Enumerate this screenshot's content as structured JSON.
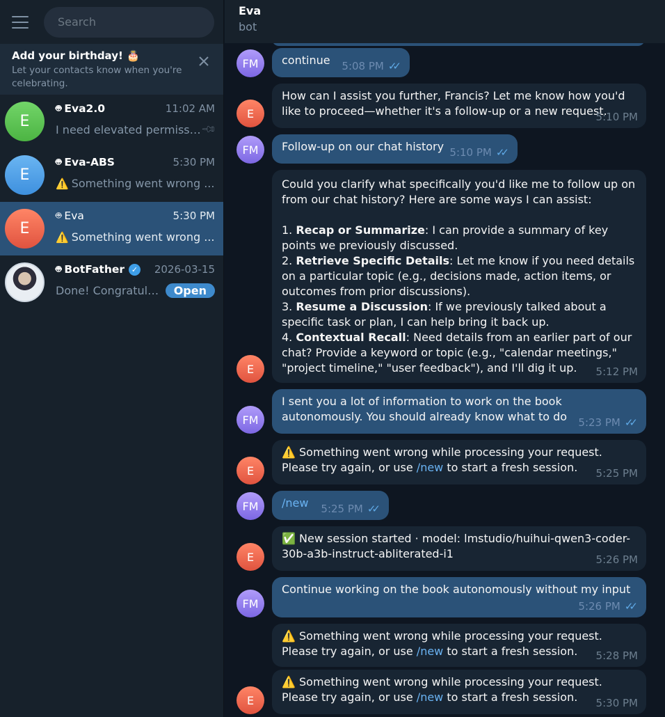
{
  "sidebar": {
    "search_placeholder": "Search",
    "birthday": {
      "title": "Add your birthday! 🎂",
      "subtitle": "Let your contacts know when you're celebrating."
    },
    "chats": [
      {
        "name": "Eva2.0",
        "time": "11:02 AM",
        "preview": "I need elevated permissi...",
        "avatar_letter": "E",
        "pinned": true
      },
      {
        "name": "Eva-ABS",
        "time": "5:30 PM",
        "preview": "Something went wrong ...",
        "avatar_letter": "E",
        "warning": true
      },
      {
        "name": "Eva",
        "time": "5:30 PM",
        "preview": "Something went wrong ...",
        "avatar_letter": "E",
        "warning": true,
        "active": true
      },
      {
        "name": "BotFather",
        "time": "2026-03-15",
        "preview": "Done! Congratulatio...",
        "verified": true,
        "badge": "Open"
      }
    ]
  },
  "header": {
    "name": "Eva",
    "status": "bot"
  },
  "messages": [
    {
      "from": "FM",
      "text": "continue",
      "time": "5:08 PM"
    },
    {
      "from": "E",
      "text": "How can I assist you further, Francis? Let me know how you'd like to proceed—whether it's a follow-up or a new request.",
      "time": "5:10 PM"
    },
    {
      "from": "FM",
      "text": "Follow-up on our chat history",
      "time": "5:10 PM"
    },
    {
      "from": "E",
      "intro": "Could you clarify what specifically you'd like me to follow up on from our chat history? Here are some ways I can assist:",
      "items": [
        {
          "n": "1.",
          "bold": "Recap or Summarize",
          "rest": ": I can provide a summary of key points we previously discussed."
        },
        {
          "n": "2.",
          "bold": "Retrieve Specific Details",
          "rest": ": Let me know if you need details on a particular topic (e.g., decisions made, action items, or outcomes from prior discussions)."
        },
        {
          "n": "3.",
          "bold": "Resume a Discussion",
          "rest": ": If we previously talked about a specific task or plan, I can help bring it back up."
        },
        {
          "n": "4.",
          "bold": "Contextual Recall",
          "rest": ": Need details from an earlier part of our chat? Provide a keyword or topic (e.g., \"calendar meetings,\" \"project timeline,\" \"user feedback\"), and I'll dig it up."
        }
      ],
      "time": "5:12 PM"
    },
    {
      "from": "FM",
      "text": "I sent you a lot of information to work on the book autonomously. You should already know what to do",
      "time": "5:23 PM"
    },
    {
      "from": "E",
      "warn_a": "Something went wrong while processing your request. Please try again, or use ",
      "link": "/new",
      "warn_b": " to start a fresh session.",
      "time": "5:25 PM"
    },
    {
      "from": "FM",
      "text": "/new",
      "time": "5:25 PM"
    },
    {
      "from": "E",
      "text": "New session started · model: lmstudio/huihui-qwen3-coder-30b-a3b-instruct-abliterated-i1",
      "time": "5:26 PM"
    },
    {
      "from": "FM",
      "text": "Continue working on the book autonomously without my input",
      "time": "5:26 PM"
    },
    {
      "from": "E",
      "warn_a": "Something went wrong while processing your request. Please try again, or use ",
      "link": "/new",
      "warn_b": " to start a fresh session.",
      "time": "5:28 PM"
    },
    {
      "from": "E",
      "warn_a": "Something went wrong while processing your request. Please try again, or use ",
      "link": "/new",
      "warn_b": " to start a fresh session.",
      "time": "5:30 PM"
    }
  ],
  "icons": {
    "menu": "hamburger-icon",
    "close": "close-icon",
    "pin": "pin-icon",
    "bot": "bot-icon",
    "verified": "verified-icon",
    "read": "double-check-icon",
    "warning": "warning-icon",
    "check": "check-mark-icon"
  },
  "colors": {
    "sidebar_bg": "#17212b",
    "chat_bg": "#0e1621",
    "outgoing": "#2b5278",
    "incoming": "#182533",
    "accent": "#6ab3f3"
  }
}
